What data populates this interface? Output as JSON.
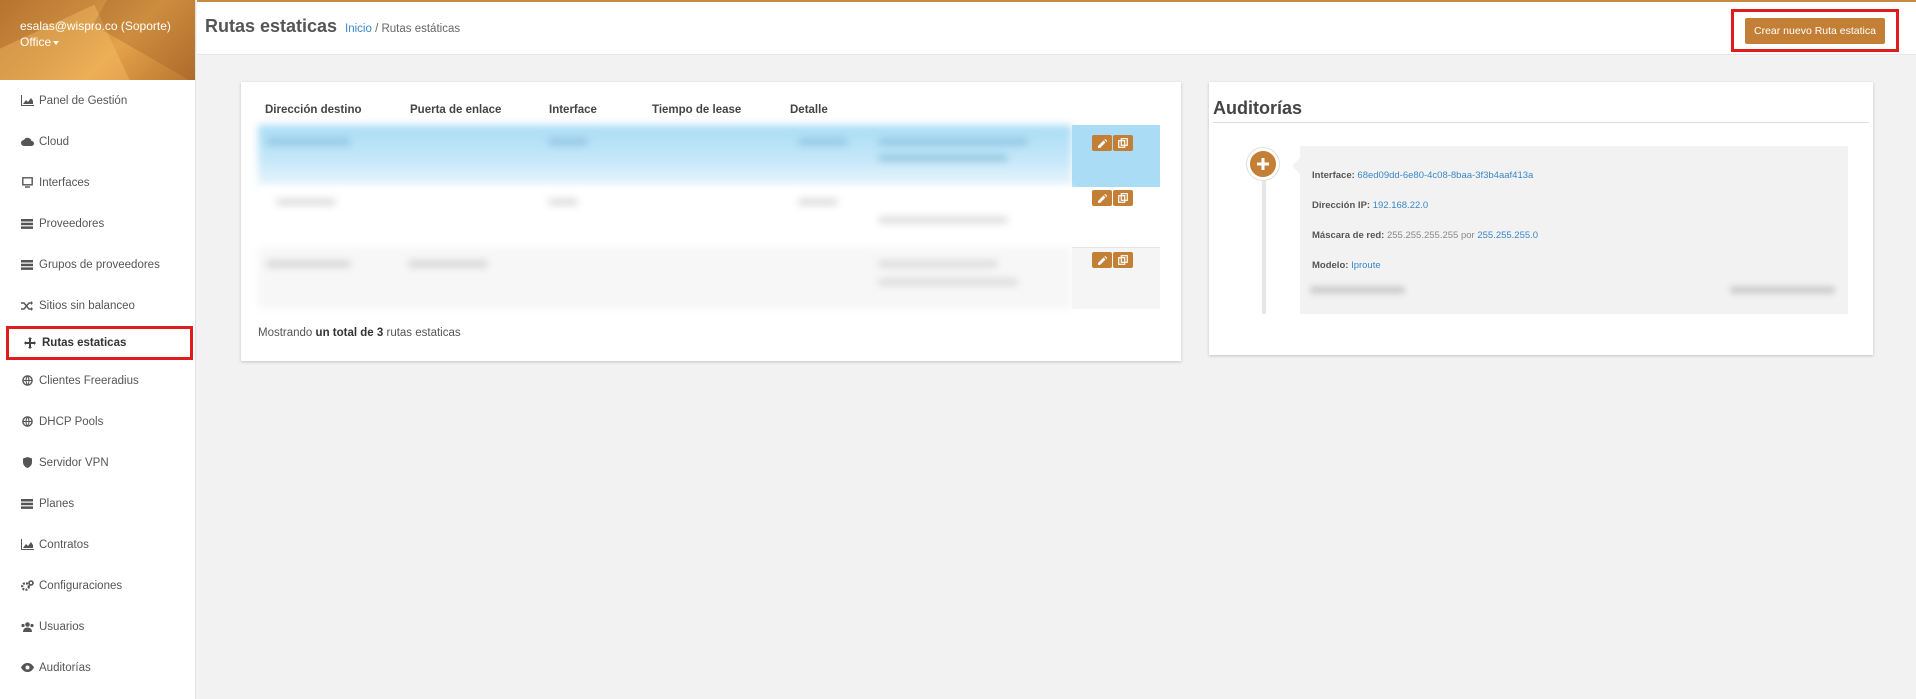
{
  "sidebar": {
    "user": "esalas@wispro.co (Soporte)",
    "org": "Office",
    "items": [
      {
        "label": "Panel de Gestión",
        "icon": "area-chart-icon"
      },
      {
        "label": "Cloud",
        "icon": "cloud-icon"
      },
      {
        "label": "Interfaces",
        "icon": "interface-icon"
      },
      {
        "label": "Proveedores",
        "icon": "server-icon"
      },
      {
        "label": "Grupos de proveedores",
        "icon": "server-group-icon"
      },
      {
        "label": "Sitios sin balanceo",
        "icon": "shuffle-icon"
      },
      {
        "label": "Rutas estaticas",
        "icon": "arrows-move-icon",
        "active": true
      },
      {
        "label": "Clientes Freeradius",
        "icon": "globe-icon"
      },
      {
        "label": "DHCP Pools",
        "icon": "globe-icon"
      },
      {
        "label": "Servidor VPN",
        "icon": "shield-icon"
      },
      {
        "label": "Planes",
        "icon": "list-icon"
      },
      {
        "label": "Contratos",
        "icon": "area-chart-icon"
      },
      {
        "label": "Configuraciones",
        "icon": "cogs-icon"
      },
      {
        "label": "Usuarios",
        "icon": "users-icon"
      },
      {
        "label": "Auditorías",
        "icon": "eye-icon"
      }
    ]
  },
  "header": {
    "title": "Rutas estaticas",
    "breadcrumb_home": "Inicio",
    "breadcrumb_sep": "/",
    "breadcrumb_current": "Rutas estáticas",
    "create_button": "Crear nuevo Ruta estatica"
  },
  "table": {
    "columns": [
      "Dirección destino",
      "Puerta de enlace",
      "Interface",
      "Tiempo de lease",
      "Detalle"
    ],
    "footer_prefix": "Mostrando",
    "footer_bold": "un total de 3",
    "footer_suffix": "rutas estaticas"
  },
  "audit": {
    "title": "Auditorías",
    "entries": [
      {
        "label": "Interface:",
        "value": "68ed09dd-6e80-4c08-8baa-3f3b4aaf413a"
      },
      {
        "label": "Dirección IP:",
        "value": "192.168.22.0"
      },
      {
        "label": "Máscara de red:",
        "old": "255.255.255.255",
        "por": "por",
        "value": "255.255.255.0"
      },
      {
        "label": "Modelo:",
        "value": "Iproute"
      }
    ]
  },
  "colors": {
    "accent": "#c27f35",
    "link": "#3a87c8",
    "highlight": "#e01d1d"
  }
}
